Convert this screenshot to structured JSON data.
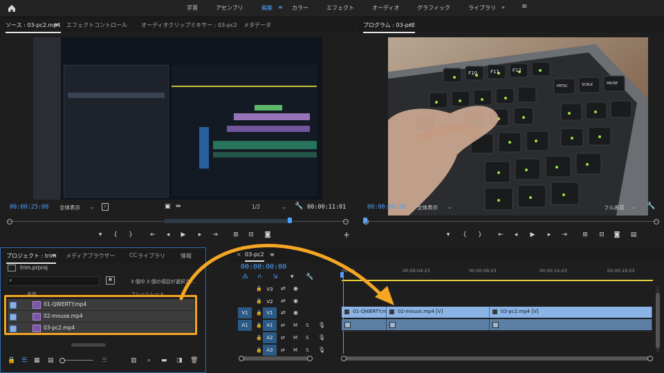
{
  "topbar": {
    "home_icon": "home-icon",
    "workspaces": [
      "学習",
      "アセンブリ",
      "編集",
      "カラー",
      "エフェクト",
      "オーディオ",
      "グラフィック",
      "ライブラリ"
    ],
    "active_workspace": "編集",
    "accent": "#4ea1ff"
  },
  "source": {
    "tabs": [
      "ソース : 03-pc2.mp4",
      "エフェクトコントロール",
      "オーディオクリップミキサー : 03-pc2",
      "メタデータ"
    ],
    "timecode_in": "00:00:25:00",
    "zoom": "全体表示",
    "resolution": "1/2",
    "timecode_out": "00:00:11:01"
  },
  "program": {
    "tab": "プログラム : 03-pc2",
    "timecode": "00:00:00:00",
    "zoom": "全体表示",
    "resolution": "フル画質",
    "keys": [
      "F10",
      "F11",
      "F12",
      "PRTSC",
      "SCRLK",
      "PAUSE"
    ]
  },
  "project": {
    "tabs": [
      "プロジェクト : trim",
      "メディアブラウザー",
      "ライブラリ",
      "情報"
    ],
    "project_file": "trim.prproj",
    "search_placeholder": "",
    "selection_info": "3 個中 3 個の項目が選択さ...",
    "col_name": "名前",
    "col_fps": "フレームレート",
    "items": [
      "01-QWERTY.mp4",
      "02-mouse.mp4",
      "03-pc2.mp4"
    ]
  },
  "timeline": {
    "tab": "03-pc2",
    "timecode": "00:00:00:00",
    "ruler": [
      "00:00",
      "00:00:04:23",
      "00:00:09:23",
      "00:00:14:23",
      "00:00:19:23"
    ],
    "video_tracks": [
      "V3",
      "V2",
      "V1"
    ],
    "audio_tracks": [
      "A1",
      "A2",
      "A3"
    ],
    "source_patch_video": "V1",
    "source_patch_audio": "A1",
    "mute": "M",
    "solo": "S",
    "clips": [
      "01-QWERTY.m",
      "02-mouse.mp4 [V]",
      "03-pc2.mp4 [V]"
    ]
  },
  "annotation": {
    "highlight_color": "#f5a623"
  }
}
